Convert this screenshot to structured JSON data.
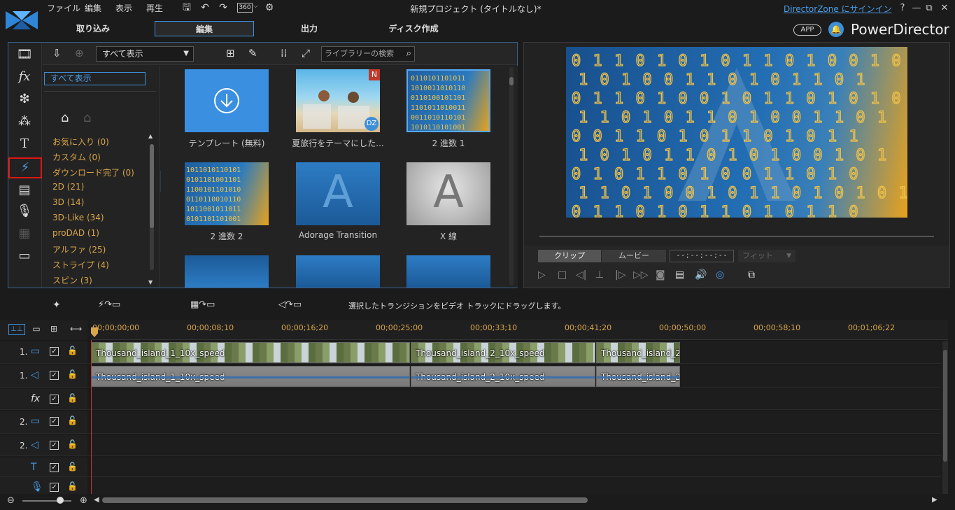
{
  "menu": [
    "ファイル",
    "編集",
    "表示",
    "再生"
  ],
  "toolbar": {
    "iso_label": "360"
  },
  "window_title": "新規プロジェクト (タイトルなし)*",
  "directorzone_link": "DirectorZone にサインイン",
  "tabs": [
    "取り込み",
    "編集",
    "出力",
    "ディスク作成"
  ],
  "app_badge": "APP",
  "brand": "PowerDirector",
  "library": {
    "dropdown_value": "すべて表示",
    "search_placeholder": "ライブラリーの検索",
    "show_all": "すべて表示",
    "categories": [
      "お気に入り (0)",
      "カスタム (0)",
      "ダウンロード完了 (0)",
      "2D (21)",
      "3D (14)",
      "3D-Like (34)",
      "proDAD (1)",
      "アルファ (25)",
      "ストライプ (4)",
      "スピン (3)"
    ],
    "items": [
      {
        "label": "テンプレート (無料)"
      },
      {
        "label": "夏旅行をテーマにした...",
        "badge": "N",
        "badge2": "DZ"
      },
      {
        "label": "2 進数 1"
      },
      {
        "label": "2 進数 2"
      },
      {
        "label": "Adorage Transition",
        "glyph": "A"
      },
      {
        "label": "X 線",
        "glyph": "A"
      }
    ]
  },
  "preview": {
    "binary_rows": [
      "0 1 1 0 1 0 1 0 1 1 0 1 0 0 1 0",
      "1 0 1 0 0 1 1 0 1 0 1 1 0 1",
      "0 1 1 0 1 0 0 1 0 1 1 0 1 0 1 0",
      "1 1 0 1 0 1 1 0 1 0 0 1 1 0 1",
      "0 0 1 1 0 1 0 1 1 0 1 0 1 1",
      "1 0 1 0 1 1 0 1 0 1 0 0 1 0 1",
      "0 1 0 1 1 0 1 0 0 1 1 0 1 0",
      "1 1 0 1 0 0 1 0 1 1 0 1 0 1 0 1",
      "0 1 1 0 1 0 1 1 0 1 0 1 1 0"
    ],
    "clip_button": "クリップ",
    "movie_button": "ムービー",
    "timecode": "- - ; - - ; - - ; - -",
    "fit_select": "フィット"
  },
  "hint": "選択したトランジションをビデオ トラックにドラッグします。",
  "ruler_ticks": [
    "00;00;00;00",
    "00;00;08;10",
    "00;00;16;20",
    "00;00;25;00",
    "00;00;33;10",
    "00;00;41;20",
    "00;00;50;00",
    "00;00;58;10",
    "00;01;06;22"
  ],
  "tracks": [
    {
      "num": "1.",
      "icon": "video-icon",
      "glyph": "▭"
    },
    {
      "num": "1.",
      "icon": "audio-icon",
      "glyph": "◁"
    },
    {
      "num": "",
      "icon": "fx-icon",
      "glyph": "fx"
    },
    {
      "num": "2.",
      "icon": "video-icon",
      "glyph": "▭"
    },
    {
      "num": "2.",
      "icon": "audio-icon",
      "glyph": "◁"
    },
    {
      "num": "",
      "icon": "title-icon",
      "glyph": "T"
    },
    {
      "num": "",
      "icon": "voice-icon",
      "glyph": "🎙"
    }
  ],
  "clips": {
    "video": [
      "Thousand_island_1_10x_speed",
      "Thousand_island_2_10x_speed",
      "Thousand_island_2_"
    ],
    "audio": [
      "Thousand_island_1_10x_speed",
      "Thousand_island_2_10x_speed",
      "Thousand_island_2_"
    ]
  },
  "colors": {
    "accent": "#3d8fd8",
    "category": "#d9a54a",
    "binary_bg": "#1e5fa0",
    "binary_gold": "#e8a21c"
  }
}
